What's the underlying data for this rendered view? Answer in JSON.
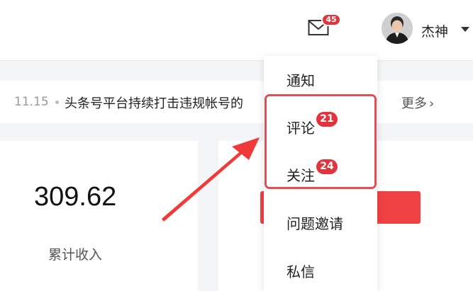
{
  "header": {
    "mail_badge": "45",
    "username": "杰神"
  },
  "notice": {
    "date": "11.15",
    "text": "头条号平台持续打击违规帐号的",
    "more_label": "更多"
  },
  "stats": {
    "revenue_value": "309.62",
    "revenue_label": "累计收入"
  },
  "dropdown": {
    "items": [
      {
        "label": "通知"
      },
      {
        "label": "评论",
        "badge": "21"
      },
      {
        "label": "关注",
        "badge": "24"
      },
      {
        "label": "问题邀请"
      },
      {
        "label": "私信"
      }
    ]
  },
  "colors": {
    "badge": "#e0353d",
    "highlight": "#e24e58",
    "arrow": "#f03a3a",
    "primary_button": "#f04142"
  },
  "icons": [
    "mail-icon",
    "chevron-down-icon",
    "chevron-right-icon"
  ]
}
